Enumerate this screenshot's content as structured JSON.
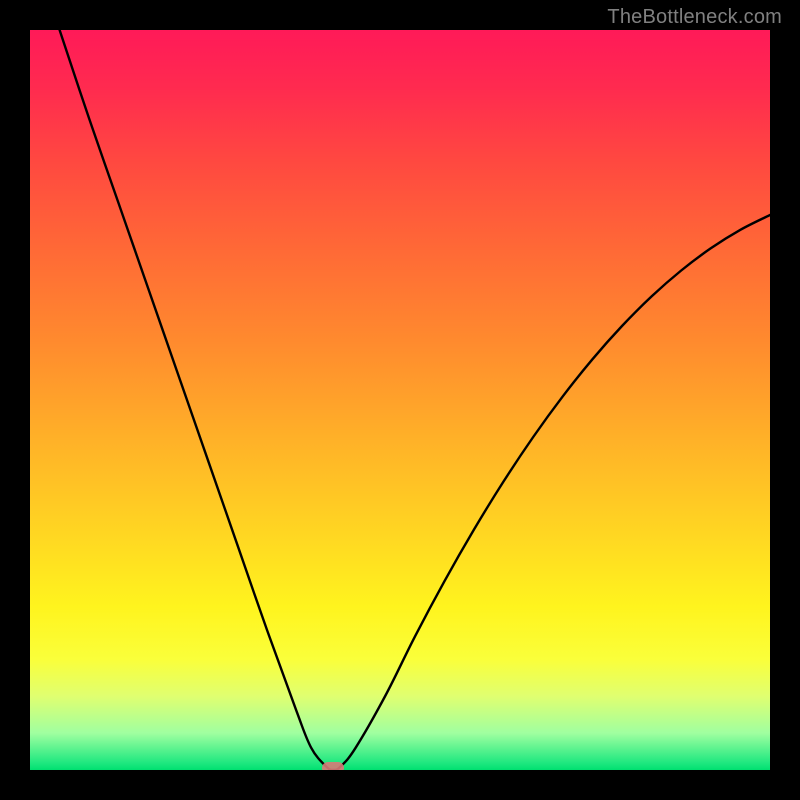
{
  "watermark": "TheBottleneck.com",
  "chart_data": {
    "type": "line",
    "title": "",
    "xlabel": "",
    "ylabel": "",
    "xlim": [
      0,
      100
    ],
    "ylim": [
      0,
      100
    ],
    "grid": false,
    "legend": false,
    "series": [
      {
        "name": "bottleneck-curve",
        "x": [
          4,
          8,
          12,
          16,
          20,
          24,
          28,
          32,
          36,
          38,
          40,
          41,
          42,
          44,
          48,
          52,
          56,
          60,
          64,
          68,
          72,
          76,
          80,
          84,
          88,
          92,
          96,
          100
        ],
        "y": [
          100,
          88,
          76.5,
          65,
          53.5,
          42,
          30.5,
          19,
          8,
          3,
          0.5,
          0,
          0.5,
          3,
          10,
          18,
          25.5,
          32.5,
          39,
          45,
          50.5,
          55.5,
          60,
          64,
          67.5,
          70.5,
          73,
          75
        ]
      }
    ],
    "marker": {
      "x": 41,
      "y": 0
    },
    "gradient": {
      "top_color": "#ff1a58",
      "mid_color": "#fff41e",
      "bottom_color": "#00e070"
    }
  }
}
